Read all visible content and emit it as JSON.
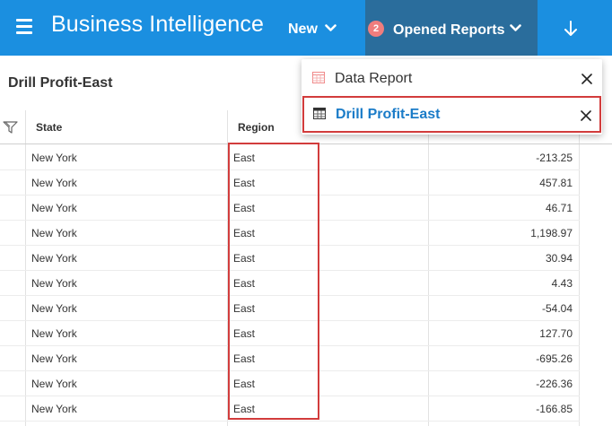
{
  "topbar": {
    "menu_icon": "hamburger-menu-icon",
    "app_title": "Business Intelligence",
    "new_label": "New",
    "new_icon": "chevron-down-icon",
    "opened_reports_badge": "2",
    "opened_reports_label": "Opened Reports",
    "opened_reports_icon": "chevron-down-icon",
    "download_icon": "arrow-down-icon",
    "colors": {
      "bar": "#1b8fe0",
      "active_tab": "#2a6d9c",
      "badge": "#f07d7d"
    }
  },
  "page": {
    "title": "Drill Profit-East"
  },
  "opened_reports_menu": {
    "items": [
      {
        "label": "Data Report",
        "icon": "report-icon",
        "close_icon": "close-icon",
        "active": false
      },
      {
        "label": "Drill Profit-East",
        "icon": "table-icon",
        "close_icon": "close-icon",
        "active": true
      }
    ]
  },
  "table": {
    "filter_icon": "filter-icon",
    "columns": [
      "State",
      "Region",
      ""
    ],
    "rows": [
      {
        "state": "New York",
        "region": "East",
        "profit": "-213.25"
      },
      {
        "state": "New York",
        "region": "East",
        "profit": "457.81"
      },
      {
        "state": "New York",
        "region": "East",
        "profit": "46.71"
      },
      {
        "state": "New York",
        "region": "East",
        "profit": "1,198.97"
      },
      {
        "state": "New York",
        "region": "East",
        "profit": "30.94"
      },
      {
        "state": "New York",
        "region": "East",
        "profit": "4.43"
      },
      {
        "state": "New York",
        "region": "East",
        "profit": "-54.04"
      },
      {
        "state": "New York",
        "region": "East",
        "profit": "127.70"
      },
      {
        "state": "New York",
        "region": "East",
        "profit": "-695.26"
      },
      {
        "state": "New York",
        "region": "East",
        "profit": "-226.36"
      },
      {
        "state": "New York",
        "region": "East",
        "profit": "-166.85"
      }
    ],
    "highlight_color": "#d23c3c"
  }
}
